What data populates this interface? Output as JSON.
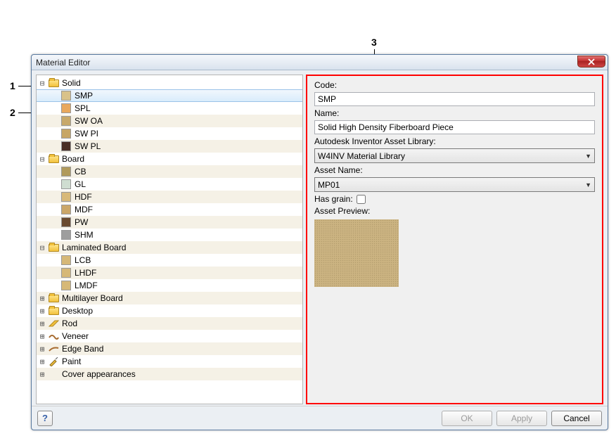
{
  "callouts": {
    "c1": "1",
    "c2": "2",
    "c3": "3"
  },
  "window": {
    "title": "Material Editor",
    "close_tooltip": "Close"
  },
  "tree": [
    {
      "exp": "⊟",
      "depth": 0,
      "icon": "folder",
      "label": "Solid",
      "alt": false
    },
    {
      "exp": "",
      "depth": 1,
      "icon": "swatch",
      "swatch": "#d9c28a",
      "label": "SMP",
      "alt": true,
      "selected": true
    },
    {
      "exp": "",
      "depth": 1,
      "icon": "swatch",
      "swatch": "#e9a85d",
      "label": "SPL",
      "alt": false
    },
    {
      "exp": "",
      "depth": 1,
      "icon": "swatch",
      "swatch": "#c8a96a",
      "label": "SW OA",
      "alt": true
    },
    {
      "exp": "",
      "depth": 1,
      "icon": "swatch",
      "swatch": "#c7a665",
      "label": "SW PI",
      "alt": false
    },
    {
      "exp": "",
      "depth": 1,
      "icon": "swatch",
      "swatch": "#4a2e24",
      "label": "SW PL",
      "alt": true
    },
    {
      "exp": "⊟",
      "depth": 0,
      "icon": "folder",
      "label": "Board",
      "alt": false
    },
    {
      "exp": "",
      "depth": 1,
      "icon": "swatch",
      "swatch": "#b19a5b",
      "label": "CB",
      "alt": true
    },
    {
      "exp": "",
      "depth": 1,
      "icon": "swatch",
      "swatch": "#cfddd1",
      "label": "GL",
      "alt": false
    },
    {
      "exp": "",
      "depth": 1,
      "icon": "swatch",
      "swatch": "#d8b979",
      "label": "HDF",
      "alt": true
    },
    {
      "exp": "",
      "depth": 1,
      "icon": "swatch",
      "swatch": "#cba768",
      "label": "MDF",
      "alt": false
    },
    {
      "exp": "",
      "depth": 1,
      "icon": "swatch",
      "swatch": "#6a4a2f",
      "label": "PW",
      "alt": true
    },
    {
      "exp": "",
      "depth": 1,
      "icon": "swatch",
      "swatch": "#9e9e9e",
      "label": "SHM",
      "alt": false
    },
    {
      "exp": "⊟",
      "depth": 0,
      "icon": "folder",
      "label": "Laminated Board",
      "alt": true
    },
    {
      "exp": "",
      "depth": 1,
      "icon": "swatch",
      "swatch": "#d6b877",
      "label": "LCB",
      "alt": false
    },
    {
      "exp": "",
      "depth": 1,
      "icon": "swatch",
      "swatch": "#d6b877",
      "label": "LHDF",
      "alt": true
    },
    {
      "exp": "",
      "depth": 1,
      "icon": "swatch",
      "swatch": "#d6b877",
      "label": "LMDF",
      "alt": false
    },
    {
      "exp": "⊞",
      "depth": 0,
      "icon": "folder",
      "label": "Multilayer Board",
      "alt": true
    },
    {
      "exp": "⊞",
      "depth": 0,
      "icon": "folder",
      "label": "Desktop",
      "alt": false
    },
    {
      "exp": "⊞",
      "depth": 0,
      "icon": "rod",
      "label": "Rod",
      "alt": true
    },
    {
      "exp": "⊞",
      "depth": 0,
      "icon": "veneer",
      "label": "Veneer",
      "alt": false
    },
    {
      "exp": "⊞",
      "depth": 0,
      "icon": "edge",
      "label": "Edge Band",
      "alt": true
    },
    {
      "exp": "⊞",
      "depth": 0,
      "icon": "paint",
      "label": "Paint",
      "alt": false
    },
    {
      "exp": "⊞",
      "depth": 0,
      "icon": "none",
      "label": "Cover appearances",
      "alt": true
    }
  ],
  "form": {
    "code_label": "Code:",
    "code_value": "SMP",
    "name_label": "Name:",
    "name_value": "Solid High Density Fiberboard Piece",
    "asset_lib_label": "Autodesk Inventor Asset Library:",
    "asset_lib_value": "W4INV Material Library",
    "asset_name_label": "Asset Name:",
    "asset_name_value": "MP01",
    "has_grain_label": "Has grain:",
    "has_grain_checked": false,
    "preview_label": "Asset Preview:"
  },
  "footer": {
    "help": "?",
    "ok": "OK",
    "apply": "Apply",
    "cancel": "Cancel"
  }
}
